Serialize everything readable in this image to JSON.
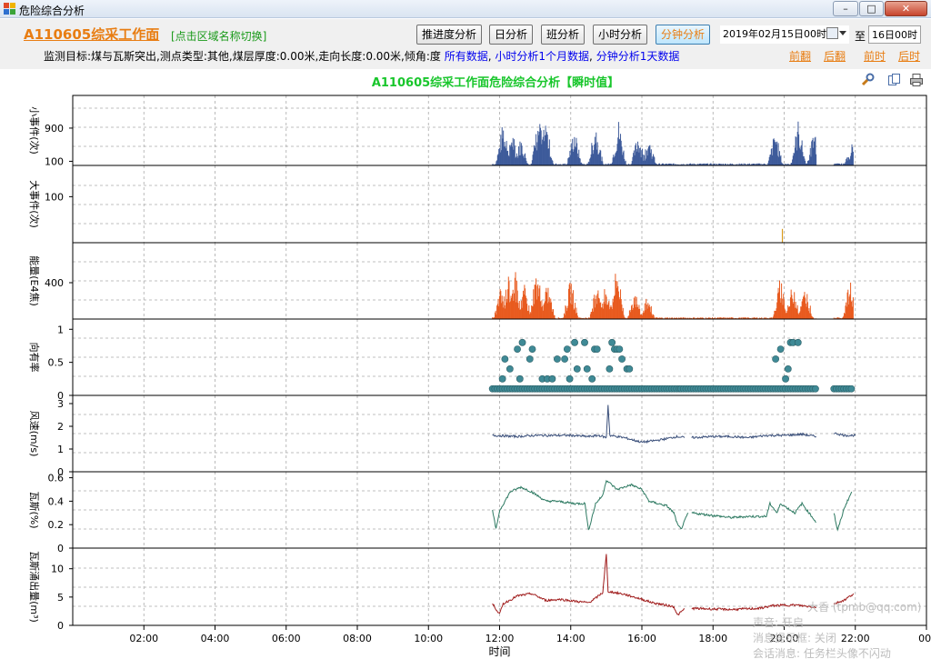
{
  "window": {
    "title": "危险综合分析",
    "minimize": "–",
    "maximize": "□",
    "close": "✕",
    "icon": "app-icon"
  },
  "toolbar": {
    "area_title": "A110605综采工作面",
    "switch_link": "[点击区域名称切换]",
    "buttons": [
      "推进度分析",
      "日分析",
      "班分析",
      "小时分析",
      "分钟分析"
    ],
    "active_button": "分钟分析",
    "start_date": "2019年02月15日00时",
    "to_label": "至",
    "end_date": "16日00时",
    "info_text": "监测目标:煤与瓦斯突出,测点类型:其他,煤层厚度:0.00米,走向长度:0.00米,倾角:度",
    "info_links": [
      "所有数据",
      "小时分析1个月数据",
      "分钟分析1天数据"
    ],
    "nav_links": [
      "前翻",
      "后翻",
      "前时",
      "后时"
    ]
  },
  "chart": {
    "title": "A110605综采工作面危险综合分析【瞬时值】",
    "tool_icons": [
      "wrench-icon",
      "copy-icon",
      "print-icon"
    ]
  },
  "chart_data": [
    {
      "type": "bar",
      "name": "small_events",
      "ylabel": "小事件(次)",
      "ylim": [
        0,
        1600
      ],
      "yticks": [
        100,
        900
      ],
      "color": "#3d5a9a",
      "peaks": [
        [
          12.1,
          1100
        ],
        [
          12.35,
          900
        ],
        [
          12.6,
          700
        ],
        [
          13.1,
          1250
        ],
        [
          13.3,
          1200
        ],
        [
          14.1,
          950
        ],
        [
          14.7,
          1100
        ],
        [
          15.35,
          1150
        ],
        [
          15.9,
          850
        ],
        [
          16.2,
          700
        ],
        [
          19.75,
          900
        ],
        [
          20.4,
          1150
        ],
        [
          20.85,
          950
        ],
        [
          21.9,
          550
        ]
      ],
      "baseline": 40,
      "active_ranges": [
        [
          11.8,
          17.1
        ],
        [
          17.1,
          20.9
        ],
        [
          21.4,
          21.95
        ]
      ]
    },
    {
      "type": "bar",
      "name": "big_events",
      "ylabel": "大事件(次)",
      "ylim": [
        0,
        160
      ],
      "yticks": [
        100
      ],
      "color": "#d99a1c",
      "points": [
        [
          19.95,
          30
        ]
      ]
    },
    {
      "type": "bar",
      "name": "energy",
      "ylabel": "能量(E4焦)",
      "ylim": [
        0,
        800
      ],
      "yticks": [
        400
      ],
      "color": "#e85a1e",
      "peaks": [
        [
          12.05,
          400
        ],
        [
          12.25,
          500
        ],
        [
          12.45,
          560
        ],
        [
          12.7,
          380
        ],
        [
          13.05,
          620
        ],
        [
          13.35,
          420
        ],
        [
          14.0,
          470
        ],
        [
          14.75,
          510
        ],
        [
          15.0,
          430
        ],
        [
          15.3,
          650
        ],
        [
          15.8,
          350
        ],
        [
          16.15,
          300
        ],
        [
          19.9,
          500
        ],
        [
          20.25,
          440
        ],
        [
          20.6,
          400
        ],
        [
          21.85,
          440
        ]
      ],
      "baseline": 15,
      "active_ranges": [
        [
          11.8,
          17.1
        ],
        [
          17.1,
          20.9
        ],
        [
          21.4,
          21.95
        ]
      ]
    },
    {
      "type": "scatter",
      "name": "directivity",
      "ylabel": "向有率",
      "ylim": [
        0,
        1.1
      ],
      "yticks": [
        0,
        0.5,
        1
      ],
      "color": "#3f8a96",
      "levels": [
        0.1,
        0.25,
        0.4,
        0.55,
        0.7,
        0.8
      ]
    },
    {
      "type": "line",
      "name": "wind_speed",
      "ylabel": "风速(m/s)",
      "ylim": [
        0,
        3.2
      ],
      "yticks": [
        0,
        1,
        2,
        3
      ],
      "color": "#3a4f7a",
      "segments": [
        [
          [
            11.8,
            1.6
          ],
          [
            12.5,
            1.55
          ],
          [
            13.0,
            1.6
          ],
          [
            13.5,
            1.6
          ],
          [
            14.0,
            1.6
          ],
          [
            14.5,
            1.55
          ],
          [
            14.8,
            1.6
          ],
          [
            15.0,
            1.5
          ],
          [
            15.05,
            2.95
          ],
          [
            15.1,
            1.6
          ],
          [
            15.5,
            1.5
          ],
          [
            16.0,
            1.3
          ],
          [
            16.5,
            1.4
          ],
          [
            17.0,
            1.55
          ],
          [
            17.2,
            1.5
          ]
        ],
        [
          [
            17.4,
            1.5
          ],
          [
            18.0,
            1.55
          ],
          [
            18.5,
            1.55
          ],
          [
            19.0,
            1.5
          ],
          [
            19.5,
            1.6
          ],
          [
            20.0,
            1.6
          ],
          [
            20.5,
            1.65
          ],
          [
            20.9,
            1.55
          ]
        ],
        [
          [
            21.4,
            1.7
          ],
          [
            21.7,
            1.6
          ],
          [
            22.0,
            1.6
          ]
        ]
      ]
    },
    {
      "type": "line",
      "name": "gas",
      "ylabel": "瓦斯(%)",
      "ylim": [
        0,
        0.62
      ],
      "yticks": [
        0,
        0.2,
        0.4,
        0.6
      ],
      "color": "#2e7a62",
      "segments": [
        [
          [
            11.8,
            0.32
          ],
          [
            11.9,
            0.16
          ],
          [
            12.0,
            0.32
          ],
          [
            12.3,
            0.48
          ],
          [
            12.6,
            0.52
          ],
          [
            12.9,
            0.48
          ],
          [
            13.3,
            0.4
          ],
          [
            13.6,
            0.4
          ],
          [
            14.1,
            0.38
          ],
          [
            14.4,
            0.38
          ],
          [
            14.5,
            0.15
          ],
          [
            14.7,
            0.38
          ],
          [
            14.9,
            0.45
          ],
          [
            15.0,
            0.58
          ],
          [
            15.3,
            0.5
          ],
          [
            15.7,
            0.54
          ],
          [
            16.0,
            0.5
          ],
          [
            16.2,
            0.4
          ],
          [
            16.7,
            0.36
          ],
          [
            16.9,
            0.3
          ],
          [
            17.0,
            0.2
          ],
          [
            17.1,
            0.16
          ],
          [
            17.3,
            0.3
          ]
        ],
        [
          [
            17.4,
            0.3
          ],
          [
            18.5,
            0.26
          ],
          [
            19.0,
            0.27
          ],
          [
            19.5,
            0.27
          ],
          [
            19.6,
            0.38
          ],
          [
            19.8,
            0.3
          ],
          [
            19.9,
            0.38
          ],
          [
            20.3,
            0.3
          ],
          [
            20.5,
            0.38
          ],
          [
            20.9,
            0.22
          ]
        ],
        [
          [
            21.4,
            0.3
          ],
          [
            21.5,
            0.15
          ],
          [
            21.7,
            0.35
          ],
          [
            21.9,
            0.48
          ]
        ]
      ]
    },
    {
      "type": "line",
      "name": "gas_emission",
      "ylabel": "瓦斯涌出量(m³)",
      "ylim": [
        0,
        13
      ],
      "yticks": [
        0,
        5,
        10
      ],
      "color": "#a01c1c",
      "segments": [
        [
          [
            11.8,
            3.8
          ],
          [
            12.0,
            2.0
          ],
          [
            12.1,
            3.8
          ],
          [
            12.5,
            5.2
          ],
          [
            12.9,
            5.6
          ],
          [
            13.3,
            4.4
          ],
          [
            13.7,
            4.6
          ],
          [
            14.2,
            4.2
          ],
          [
            14.5,
            4.0
          ],
          [
            14.7,
            4.8
          ],
          [
            14.9,
            5.8
          ],
          [
            15.0,
            12.5
          ],
          [
            15.05,
            6.0
          ],
          [
            15.5,
            5.5
          ],
          [
            16.0,
            4.6
          ],
          [
            16.3,
            4.0
          ],
          [
            16.9,
            3.3
          ],
          [
            17.0,
            1.8
          ],
          [
            17.2,
            2.9
          ]
        ],
        [
          [
            17.4,
            3.0
          ],
          [
            18.5,
            2.8
          ],
          [
            19.3,
            3.0
          ],
          [
            19.7,
            3.5
          ],
          [
            20.3,
            3.6
          ],
          [
            20.9,
            3.2
          ]
        ],
        [
          [
            21.4,
            3.8
          ],
          [
            21.7,
            4.5
          ],
          [
            21.95,
            5.6
          ]
        ]
      ]
    }
  ],
  "x_axis": {
    "label": "时间",
    "range_hours": [
      0,
      24
    ],
    "ticks": [
      "02:00",
      "04:00",
      "06:00",
      "08:00",
      "10:00",
      "12:00",
      "14:00",
      "16:00",
      "18:00",
      "20:00",
      "22:00",
      "00:"
    ]
  },
  "watermark": {
    "line1": "大香 (tpmb@qq.com)",
    "line2": "声音: 开启",
    "line3": "消息提示框: 关闭",
    "line4": "会话消息: 任务栏头像不闪动"
  }
}
